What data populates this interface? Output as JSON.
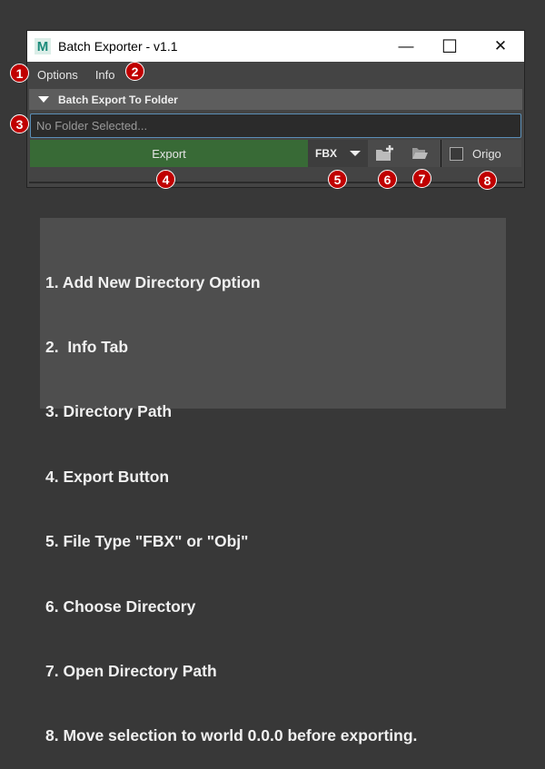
{
  "window": {
    "title": "Batch Exporter - v1.1",
    "logo": "M",
    "minimize": "—",
    "maximize": "☐",
    "close": "✕"
  },
  "menu": [
    "Options",
    "Info"
  ],
  "section": {
    "title": "Batch Export To Folder"
  },
  "path_input": {
    "placeholder": "No Folder Selected...",
    "value": ""
  },
  "toolbar": {
    "export_label": "Export",
    "file_type": "FBX",
    "origo_label": "Origo",
    "origo_checked": false
  },
  "badges": [
    "1",
    "2",
    "3",
    "4",
    "5",
    "6",
    "7",
    "8"
  ],
  "notes": [
    "1. Add New Directory Option",
    "2.  Info Tab",
    "3. Directory Path",
    "4. Export Button",
    "5. File Type \"FBX\" or \"Obj\"",
    "6. Choose Directory",
    "7. Open Directory Path",
    "8. Move selection to world 0.0.0 before exporting."
  ],
  "colors": {
    "export": "#386a36",
    "badge": "#c00000",
    "focus": "#5b8fb8"
  }
}
